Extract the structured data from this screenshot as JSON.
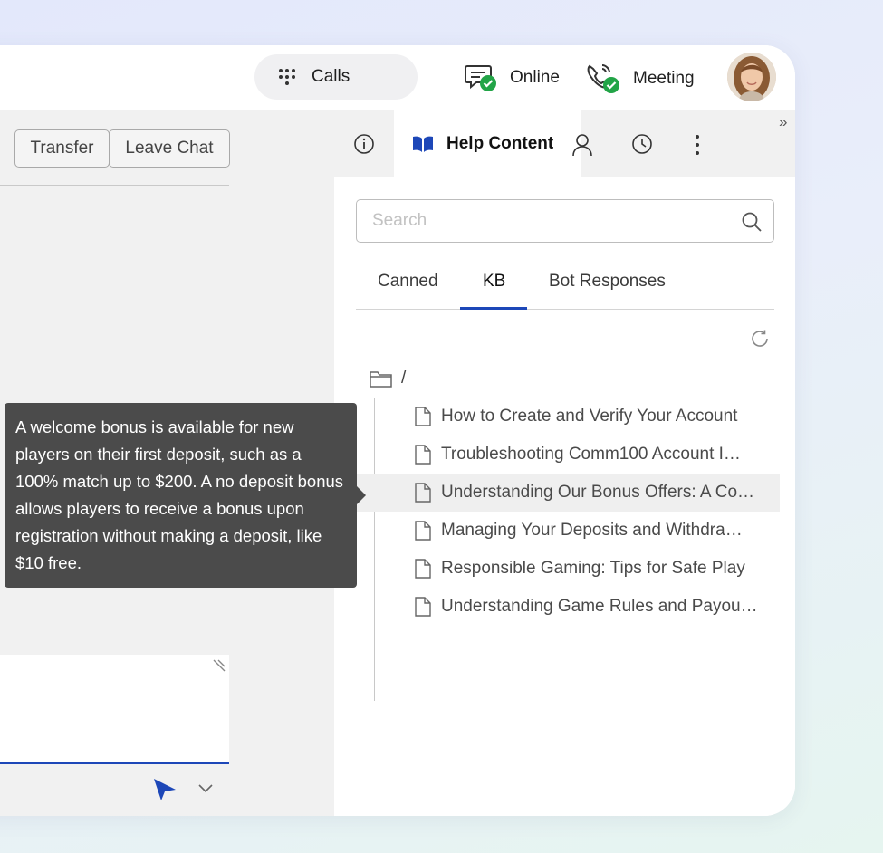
{
  "header": {
    "calls_label": "Calls",
    "online_label": "Online",
    "meeting_label": "Meeting"
  },
  "chat": {
    "transfer_label": "Transfer",
    "leave_label": "Leave Chat"
  },
  "tooltip": {
    "text": "A welcome bonus is available for new players on their first deposit, such as a 100% match up to $200. A no deposit bonus allows players to receive a bonus upon registration without making a deposit, like $10 free."
  },
  "right_panel": {
    "active_tab_label": "Help Content",
    "search_placeholder": "Search",
    "subtabs": [
      "Canned",
      "KB",
      "Bot Responses"
    ],
    "active_subtab": "KB",
    "tree_root_label": "/",
    "articles": [
      "How to Create and Verify Your Account",
      "Troubleshooting Comm100 Account I…",
      "Understanding Our Bonus Offers: A Co…",
      "Managing Your Deposits and Withdra…",
      "Responsible Gaming: Tips for Safe Play",
      "Understanding Game Rules and Payou…"
    ],
    "selected_article_index": 2
  },
  "colors": {
    "accent": "#1d47b8",
    "status_green": "#22a447",
    "tooltip_bg": "#4b4b4b"
  },
  "icons": [
    "dialpad-icon",
    "chat-online-icon",
    "phone-meeting-icon",
    "info-icon",
    "book-icon",
    "person-icon",
    "history-icon",
    "more-icon",
    "collapse-icon",
    "search-icon",
    "refresh-icon",
    "folder-icon",
    "file-icon",
    "send-icon",
    "chevron-down-icon"
  ]
}
